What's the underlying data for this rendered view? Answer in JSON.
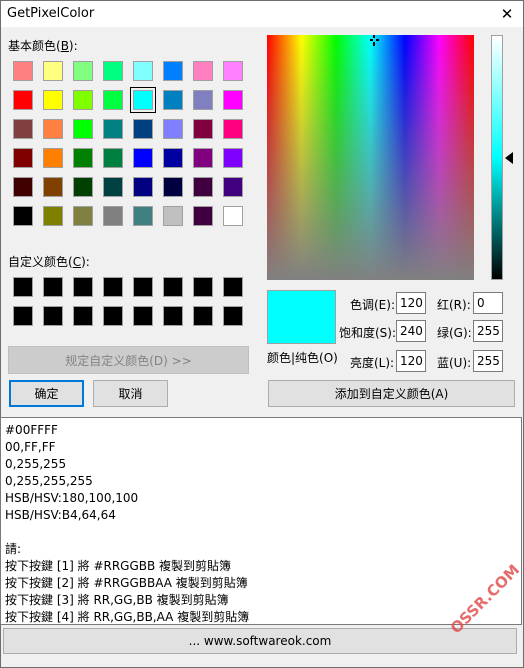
{
  "title": "GetPixelColor",
  "basic_colors_label": "基本颜色(",
  "basic_colors_key": "B",
  "basic_colors_suffix": "):",
  "basic_colors": [
    [
      "#ff8080",
      "#ffff80",
      "#80ff80",
      "#00ff80",
      "#80ffff",
      "#0080ff",
      "#ff80c0",
      "#ff80ff"
    ],
    [
      "#ff0000",
      "#ffff00",
      "#80ff00",
      "#00ff40",
      "#00ffff",
      "#0080c0",
      "#8080c0",
      "#ff00ff"
    ],
    [
      "#804040",
      "#ff8040",
      "#00ff00",
      "#008080",
      "#004080",
      "#8080ff",
      "#800040",
      "#ff0080"
    ],
    [
      "#800000",
      "#ff8000",
      "#008000",
      "#008040",
      "#0000ff",
      "#0000a0",
      "#800080",
      "#8000ff"
    ],
    [
      "#400000",
      "#804000",
      "#004000",
      "#004040",
      "#000080",
      "#000040",
      "#400040",
      "#400080"
    ],
    [
      "#000000",
      "#808000",
      "#808040",
      "#808080",
      "#408080",
      "#c0c0c0",
      "#400040",
      "#ffffff"
    ]
  ],
  "custom_colors_label": "自定义颜色(",
  "custom_colors_key": "C",
  "custom_colors_suffix": "):",
  "define_custom_button": "规定自定义颜色(D) >>",
  "ok_button": "确定",
  "cancel_button": "取消",
  "color_solid_label": "颜色|纯色(O)",
  "hue_label": "色调(E):",
  "sat_label": "饱和度(S):",
  "lum_label": "亮度(L):",
  "red_label": "红(R):",
  "green_label": "绿(G):",
  "blue_label": "蓝(U):",
  "hue_value": "120",
  "sat_value": "240",
  "lum_value": "120",
  "red_value": "0",
  "green_value": "255",
  "blue_value": "255",
  "add_custom_button": "添加到自定义颜色(A)",
  "output_lines": [
    "#00FFFF",
    "00,FF,FF",
    "0,255,255",
    "0,255,255,255",
    "HSB/HSV:180,100,100",
    "HSB/HSV:B4,64,64",
    "",
    "請:",
    "按下按鍵 [1] 將 #RRGGBB 複製到剪貼簿",
    "按下按鍵 [2] 將 #RRGGBBAA 複製到剪貼簿",
    "按下按鍵 [3] 將 RR,GG,BB 複製到剪貼簿",
    "按下按鍵 [4] 將 RR,GG,BB,AA 複製到剪貼簿"
  ],
  "bottom_button": "... www.softwareok.com",
  "watermark": "OSSR.COM",
  "preview_color": "#00ffff",
  "selected_basic": [
    1,
    4
  ]
}
